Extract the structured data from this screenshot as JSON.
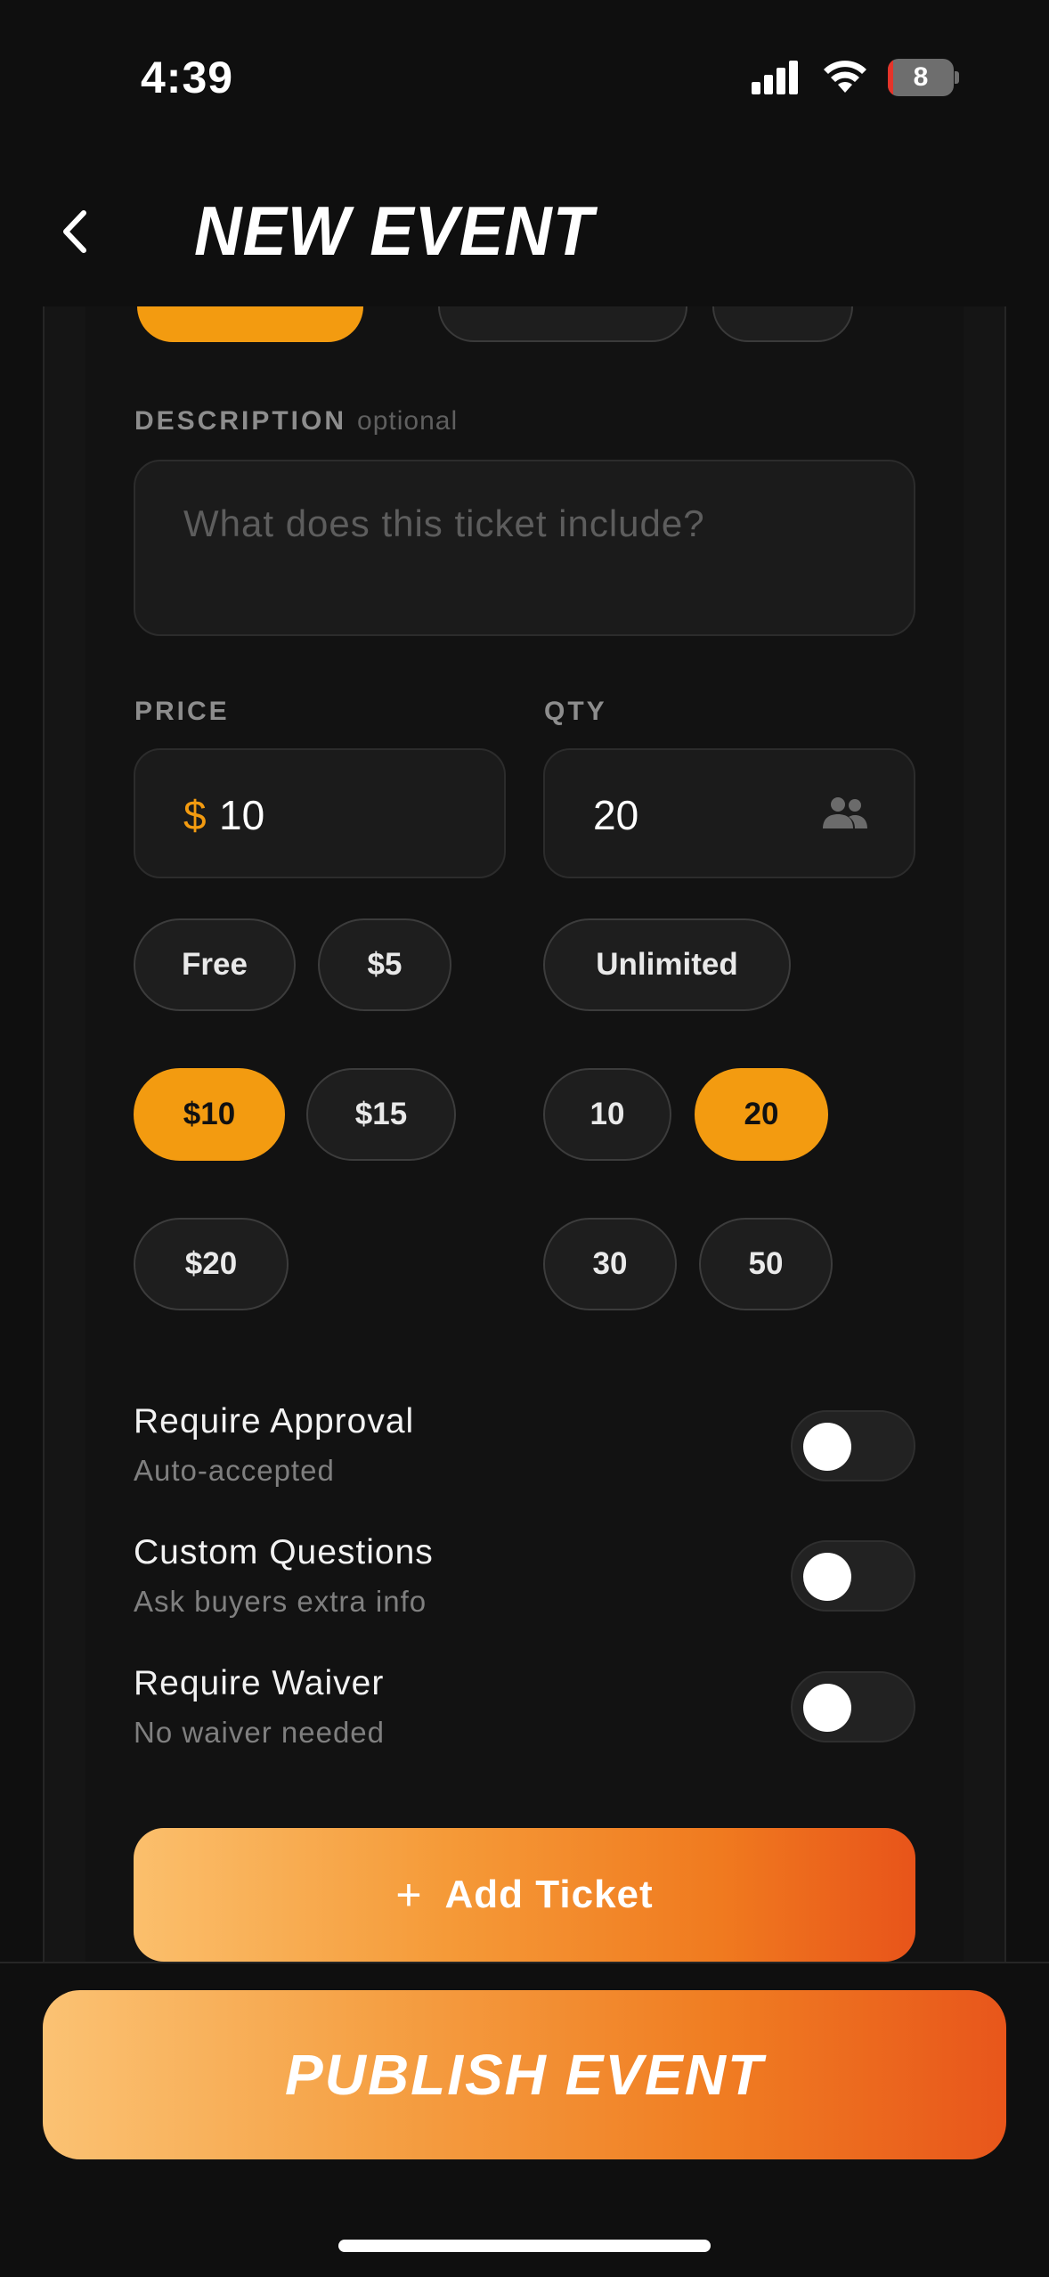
{
  "status_bar": {
    "time": "4:39",
    "battery_level": "8",
    "battery_fraction": 0.08
  },
  "header": {
    "title": "NEW EVENT"
  },
  "ticket": {
    "description": {
      "label": "DESCRIPTION",
      "optional": "optional",
      "placeholder": "What does this ticket include?"
    },
    "price": {
      "label": "PRICE",
      "currency": "$",
      "value": "10",
      "options": [
        "Free",
        "$5",
        "$10",
        "$15",
        "$20"
      ],
      "selected": "$10"
    },
    "qty": {
      "label": "QTY",
      "value": "20",
      "options": [
        "Unlimited",
        "10",
        "20",
        "30",
        "50"
      ],
      "selected": "20"
    },
    "settings": [
      {
        "title": "Require Approval",
        "subtitle": "Auto-accepted",
        "enabled": false
      },
      {
        "title": "Custom Questions",
        "subtitle": "Ask buyers extra info",
        "enabled": false
      },
      {
        "title": "Require Waiver",
        "subtitle": "No waiver needed",
        "enabled": false
      }
    ],
    "add_ticket_label": "Add Ticket"
  },
  "publish_label": "PUBLISH EVENT",
  "colors": {
    "accent": "#f39b10",
    "background": "#0f0f0f",
    "gradient_start": "#fbbf6c",
    "gradient_end": "#e8541a"
  },
  "icons": {
    "back": "chevron-left-icon",
    "qty": "people-icon",
    "add": "plus-icon"
  }
}
